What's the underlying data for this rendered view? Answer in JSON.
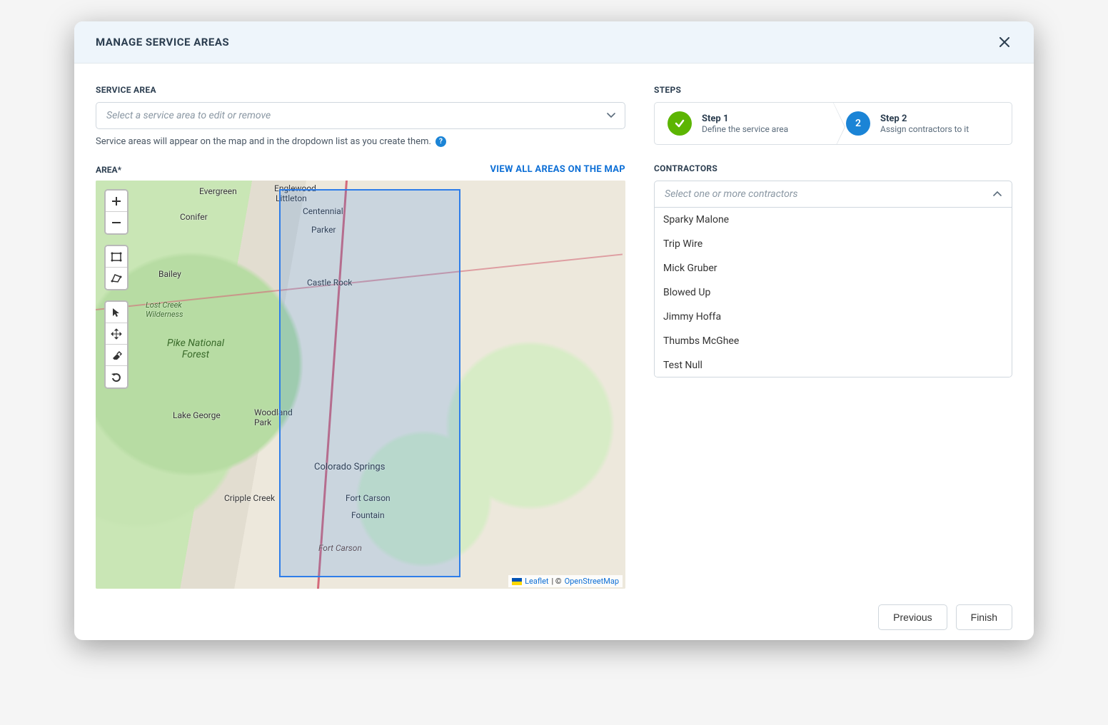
{
  "header": {
    "title": "MANAGE SERVICE AREAS"
  },
  "serviceArea": {
    "label": "SERVICE AREA",
    "placeholder": "Select a service area to edit or remove",
    "helper": "Service areas will appear on the map and in the dropdown list as you create them."
  },
  "area": {
    "label": "AREA*",
    "viewAll": "VIEW ALL AREAS ON THE MAP"
  },
  "map": {
    "forestLabel": "Pike National\nForest",
    "wildernessLabel": "Lost Creek\nWilderness",
    "cities": {
      "evergreen": "Evergreen",
      "conifer": "Conifer",
      "bailey": "Bailey",
      "englewood": "Englewood",
      "littleton": "Littleton",
      "centennial": "Centennial",
      "parker": "Parker",
      "castleRock": "Castle Rock",
      "coloradoSprings": "Colorado Springs",
      "fortCarson": "Fort Carson",
      "fountain": "Fountain",
      "fortCarson2": "Fort Carson",
      "crippleCreek": "Cripple Creek",
      "lakeGeorge": "Lake George",
      "woodlandPark": "Woodland\nPark"
    },
    "attrib": {
      "leaflet": "Leaflet",
      "sep": " | © ",
      "osm": "OpenStreetMap"
    }
  },
  "steps": {
    "label": "STEPS",
    "step1": {
      "title": "Step 1",
      "sub": "Define the service area"
    },
    "step2": {
      "num": "2",
      "title": "Step 2",
      "sub": "Assign contractors to it"
    }
  },
  "contractors": {
    "label": "CONTRACTORS",
    "placeholder": "Select one or more contractors",
    "items": [
      "Sparky Malone",
      "Trip Wire",
      "Mick Gruber",
      "Blowed Up",
      "Jimmy Hoffa",
      "Thumbs McGhee",
      "Test Null"
    ]
  },
  "footer": {
    "previous": "Previous",
    "finish": "Finish"
  }
}
